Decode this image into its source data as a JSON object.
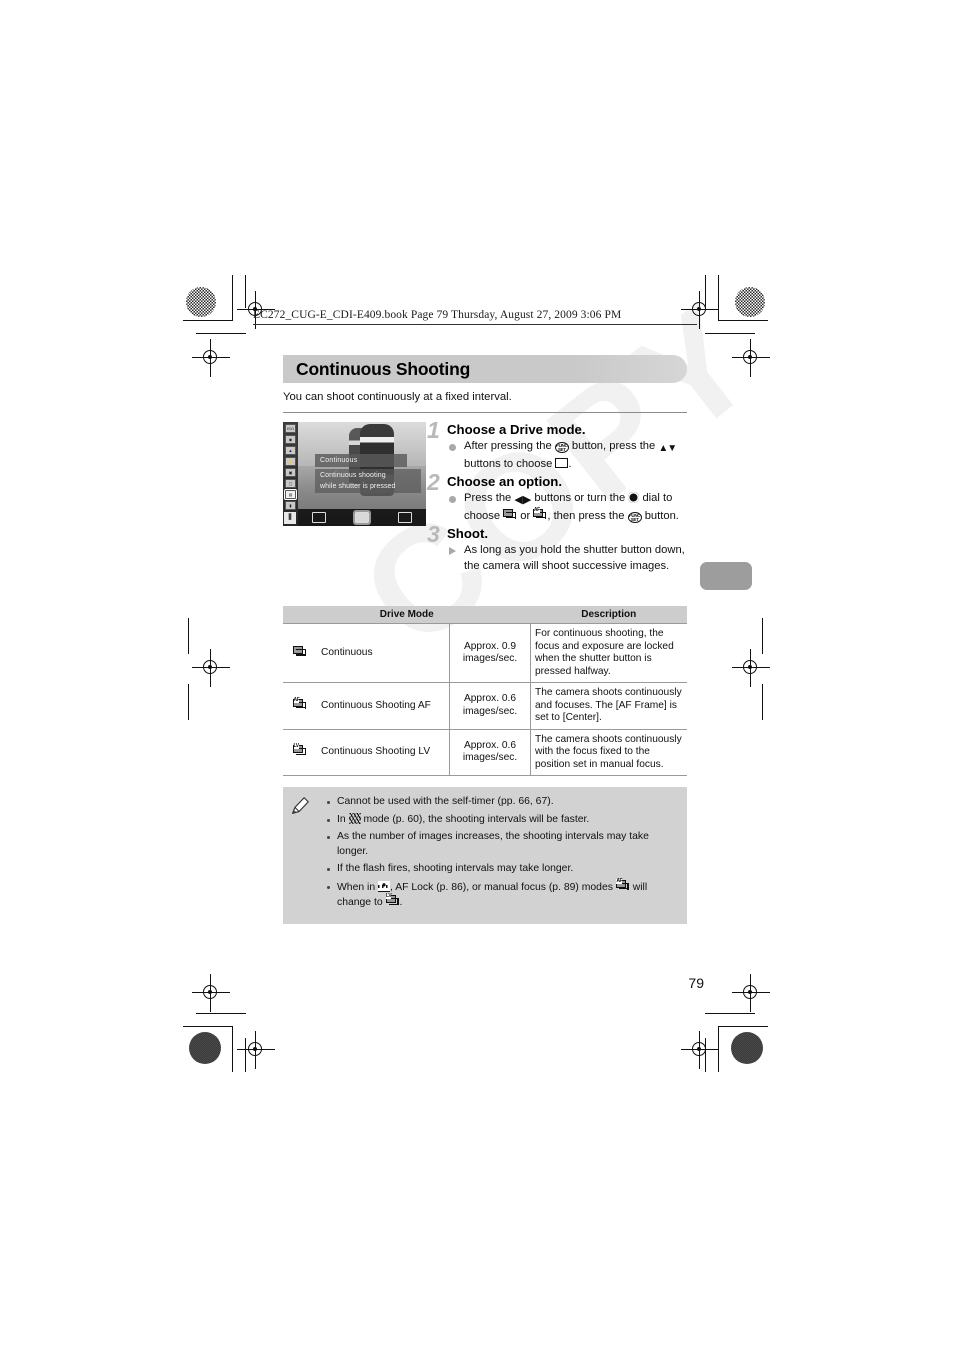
{
  "file_header": "EC272_CUG-E_CDI-E409.book  Page 79  Thursday, August 27, 2009  3:06 PM",
  "watermark": "COPY",
  "page_number": "79",
  "section": {
    "title": "Continuous Shooting",
    "intro": "You can shoot continuously at a fixed interval."
  },
  "camera_screen": {
    "tooltip_title": "Continuous",
    "tooltip_line1": "Continuous shooting",
    "tooltip_line2": "while shutter is pressed"
  },
  "steps": [
    {
      "number": "1",
      "heading": "Choose a Drive mode.",
      "bullet_type": "dot",
      "text_a": "After pressing the",
      "text_b": "button, press the",
      "text_c": "buttons to choose",
      "text_d": "."
    },
    {
      "number": "2",
      "heading": "Choose an option.",
      "bullet_type": "dot",
      "text_a": "Press the",
      "text_b": "buttons or turn the",
      "text_c": "dial to choose",
      "text_d": "or",
      "text_e": ", then press the",
      "text_f": "button."
    },
    {
      "number": "3",
      "heading": "Shoot.",
      "bullet_type": "triangle",
      "text_a": "As long as you hold the shutter button down, the camera will shoot successive images."
    }
  ],
  "table": {
    "headers": {
      "drive_mode": "Drive Mode",
      "description": "Description"
    },
    "rows": [
      {
        "icon": "burst-icon",
        "name": "Continuous",
        "rate_line1": "Approx. 0.9",
        "rate_line2": "images/sec.",
        "description": "For continuous shooting, the focus and exposure are locked when the shutter button is pressed halfway."
      },
      {
        "icon": "burst-af-icon",
        "name": "Continuous Shooting AF",
        "rate_line1": "Approx. 0.6",
        "rate_line2": "images/sec.",
        "description": "The camera shoots continuously and focuses. The [AF Frame] is set to [Center]."
      },
      {
        "icon": "burst-lv-icon",
        "name": "Continuous Shooting LV",
        "rate_line1": "Approx. 0.6",
        "rate_line2": "images/sec.",
        "description": "The camera shoots continuously with the focus fixed to the position set in manual focus."
      }
    ]
  },
  "notes": [
    {
      "text_a": "Cannot be used with the self-timer (pp. 66, 67)."
    },
    {
      "text_a": "In",
      "text_b": "mode (p. 60), the shooting intervals will be faster."
    },
    {
      "text_a": "As the number of images increases, the shooting intervals may take longer."
    },
    {
      "text_a": "If the flash fires, shooting intervals may take longer."
    },
    {
      "text_a": "When in",
      "text_b": ", AF Lock (p. 86), or manual focus (p. 89) modes",
      "text_c": "will change to",
      "text_d": "."
    }
  ],
  "colors": {
    "title_bar": "#c9c9c9",
    "notes_bg": "#d2d2d2",
    "table_header_bg": "#cdcdcd",
    "side_tab": "#9d9d9d",
    "step_number": "#b9b9b9"
  }
}
